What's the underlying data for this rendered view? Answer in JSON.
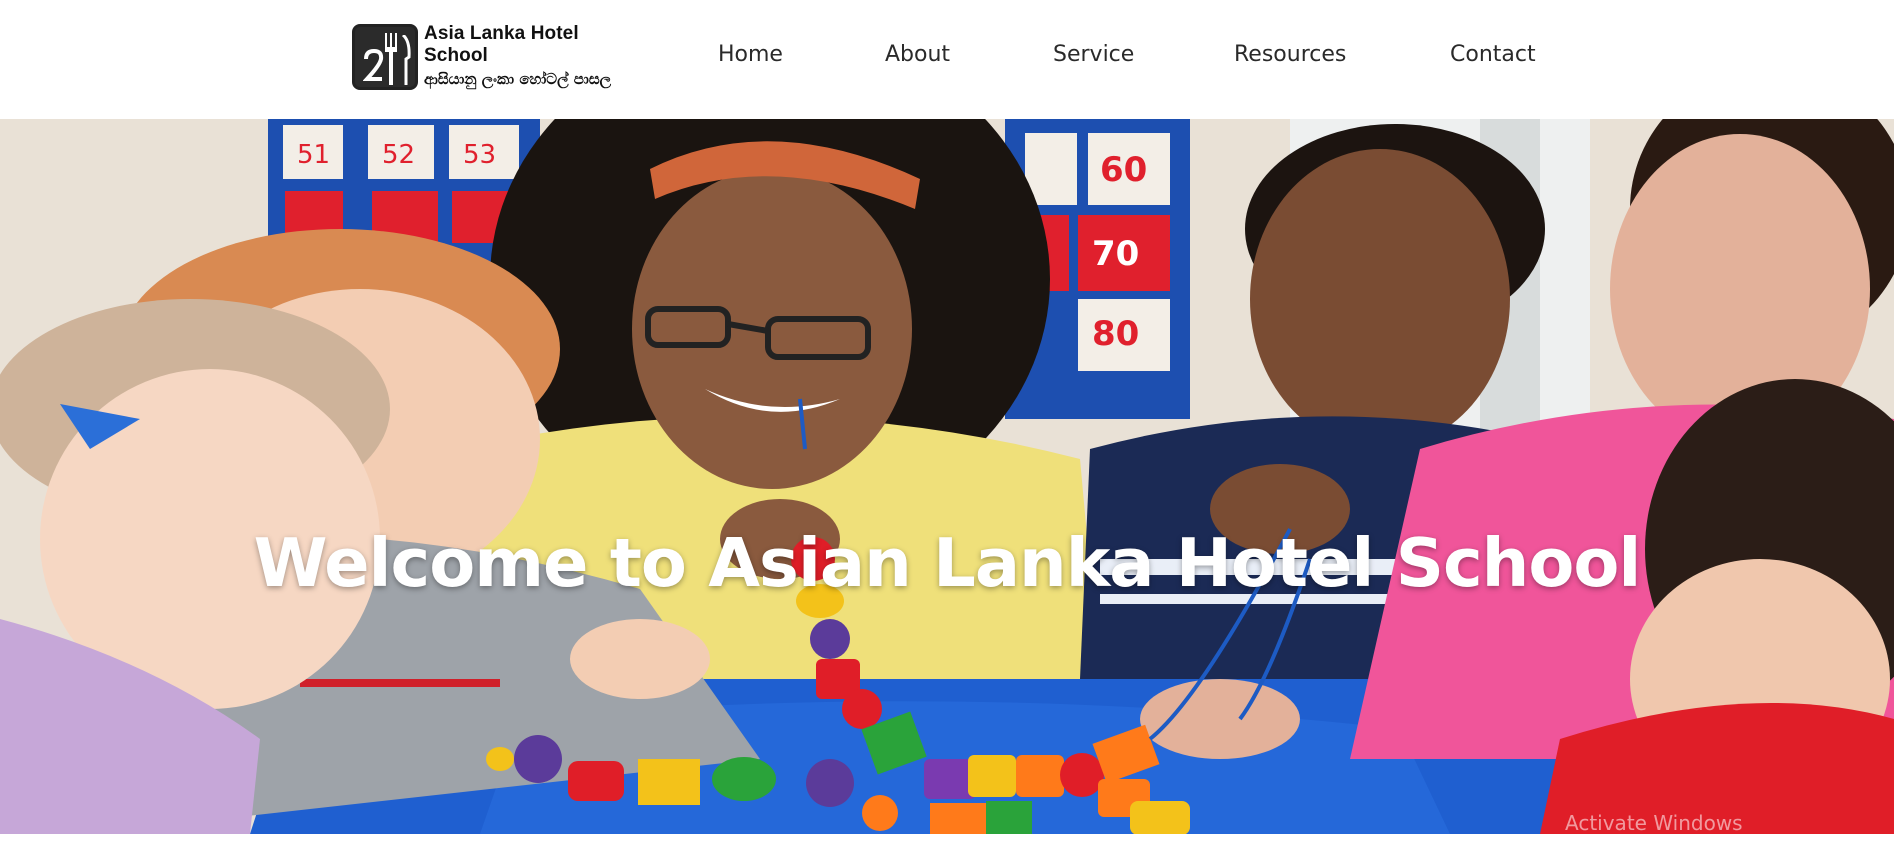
{
  "header": {
    "logo": {
      "title": "Asia Lanka Hotel School",
      "subtitle": "ආසියානු ලංකා හෝටල් පාසල"
    },
    "nav": [
      {
        "label": "Home"
      },
      {
        "label": "About"
      },
      {
        "label": "Service"
      },
      {
        "label": "Resources"
      },
      {
        "label": "Contact"
      }
    ]
  },
  "hero": {
    "title": "Welcome to Asian Lanka Hotel School",
    "image_icon": "classroom-photo",
    "chart_numbers": [
      "51",
      "52",
      "53",
      "60",
      "70",
      "80"
    ]
  },
  "system": {
    "watermark": "Activate Windows"
  },
  "colors": {
    "nav_text": "#2a2a2a",
    "hero_title": "#ffffff",
    "table_blue": "#1d5bc4"
  }
}
